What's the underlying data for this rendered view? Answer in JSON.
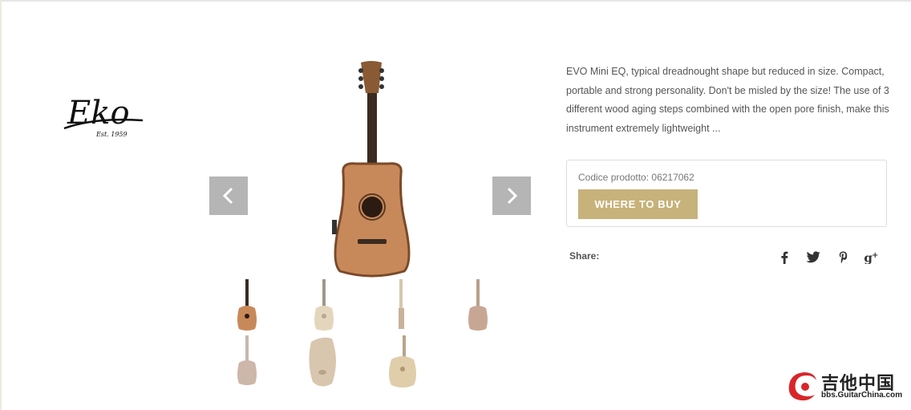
{
  "brand": {
    "logo_text": "Eko",
    "logo_tagline": "Est. 1959"
  },
  "product": {
    "description": "EVO Mini EQ, typical dreadnought shape but reduced in size. Compact, portable and strong personality. Don't be misled by the size! The use of 3 different wood aging steps combined with the open pore finish, make this instrument extremely lightweight ...",
    "code_label": "Codice prodotto: 06217062",
    "buy_label": "WHERE TO BUY"
  },
  "share": {
    "label": "Share:",
    "icons": [
      "facebook-icon",
      "twitter-icon",
      "pinterest-icon",
      "google-plus-icon"
    ]
  },
  "gallery": {
    "thumbnails": [
      "front",
      "front-light",
      "side",
      "back",
      "back-small",
      "angle",
      "angle-light"
    ]
  },
  "watermark": {
    "title": "吉他中国",
    "subtitle": "bbs.GuitarChina.com"
  },
  "colors": {
    "accent": "#c7b27b",
    "nav": "#b5b5b5",
    "border": "#dddddd"
  }
}
